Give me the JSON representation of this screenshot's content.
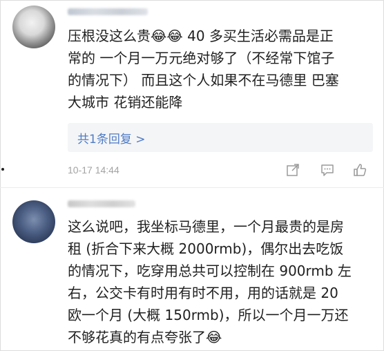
{
  "comments": [
    {
      "text": "压根没这么贵😂😂 40 多买生活必需品是正\n常的  一个月一万元绝对够了（不经常下馆子\n的情况下） 而且这个人如果不在马德里 巴塞\n大城市 花销还能降",
      "replies_label": "共1条回复 >",
      "date": "10-17 14:44",
      "actions": [
        "share-icon",
        "reply-icon",
        "like-icon"
      ]
    },
    {
      "text": "这么说吧，我坐标马德里，一个月最贵的是房\n租 (折合下来大概 2000rmb)，偶尔出去吃饭\n的情况下，吃穿用总共可以控制在 900rmb 左\n右，公交卡有时用有时不用，用的话就是 20\n欧一个月 (大概 150rmb)，所以一个月一万还\n不够花真的有点夸张了😂"
    }
  ],
  "colors": {
    "link": "#4f7cc5",
    "meta": "#a3a3a3",
    "reply_box": "#f4f5f7"
  }
}
